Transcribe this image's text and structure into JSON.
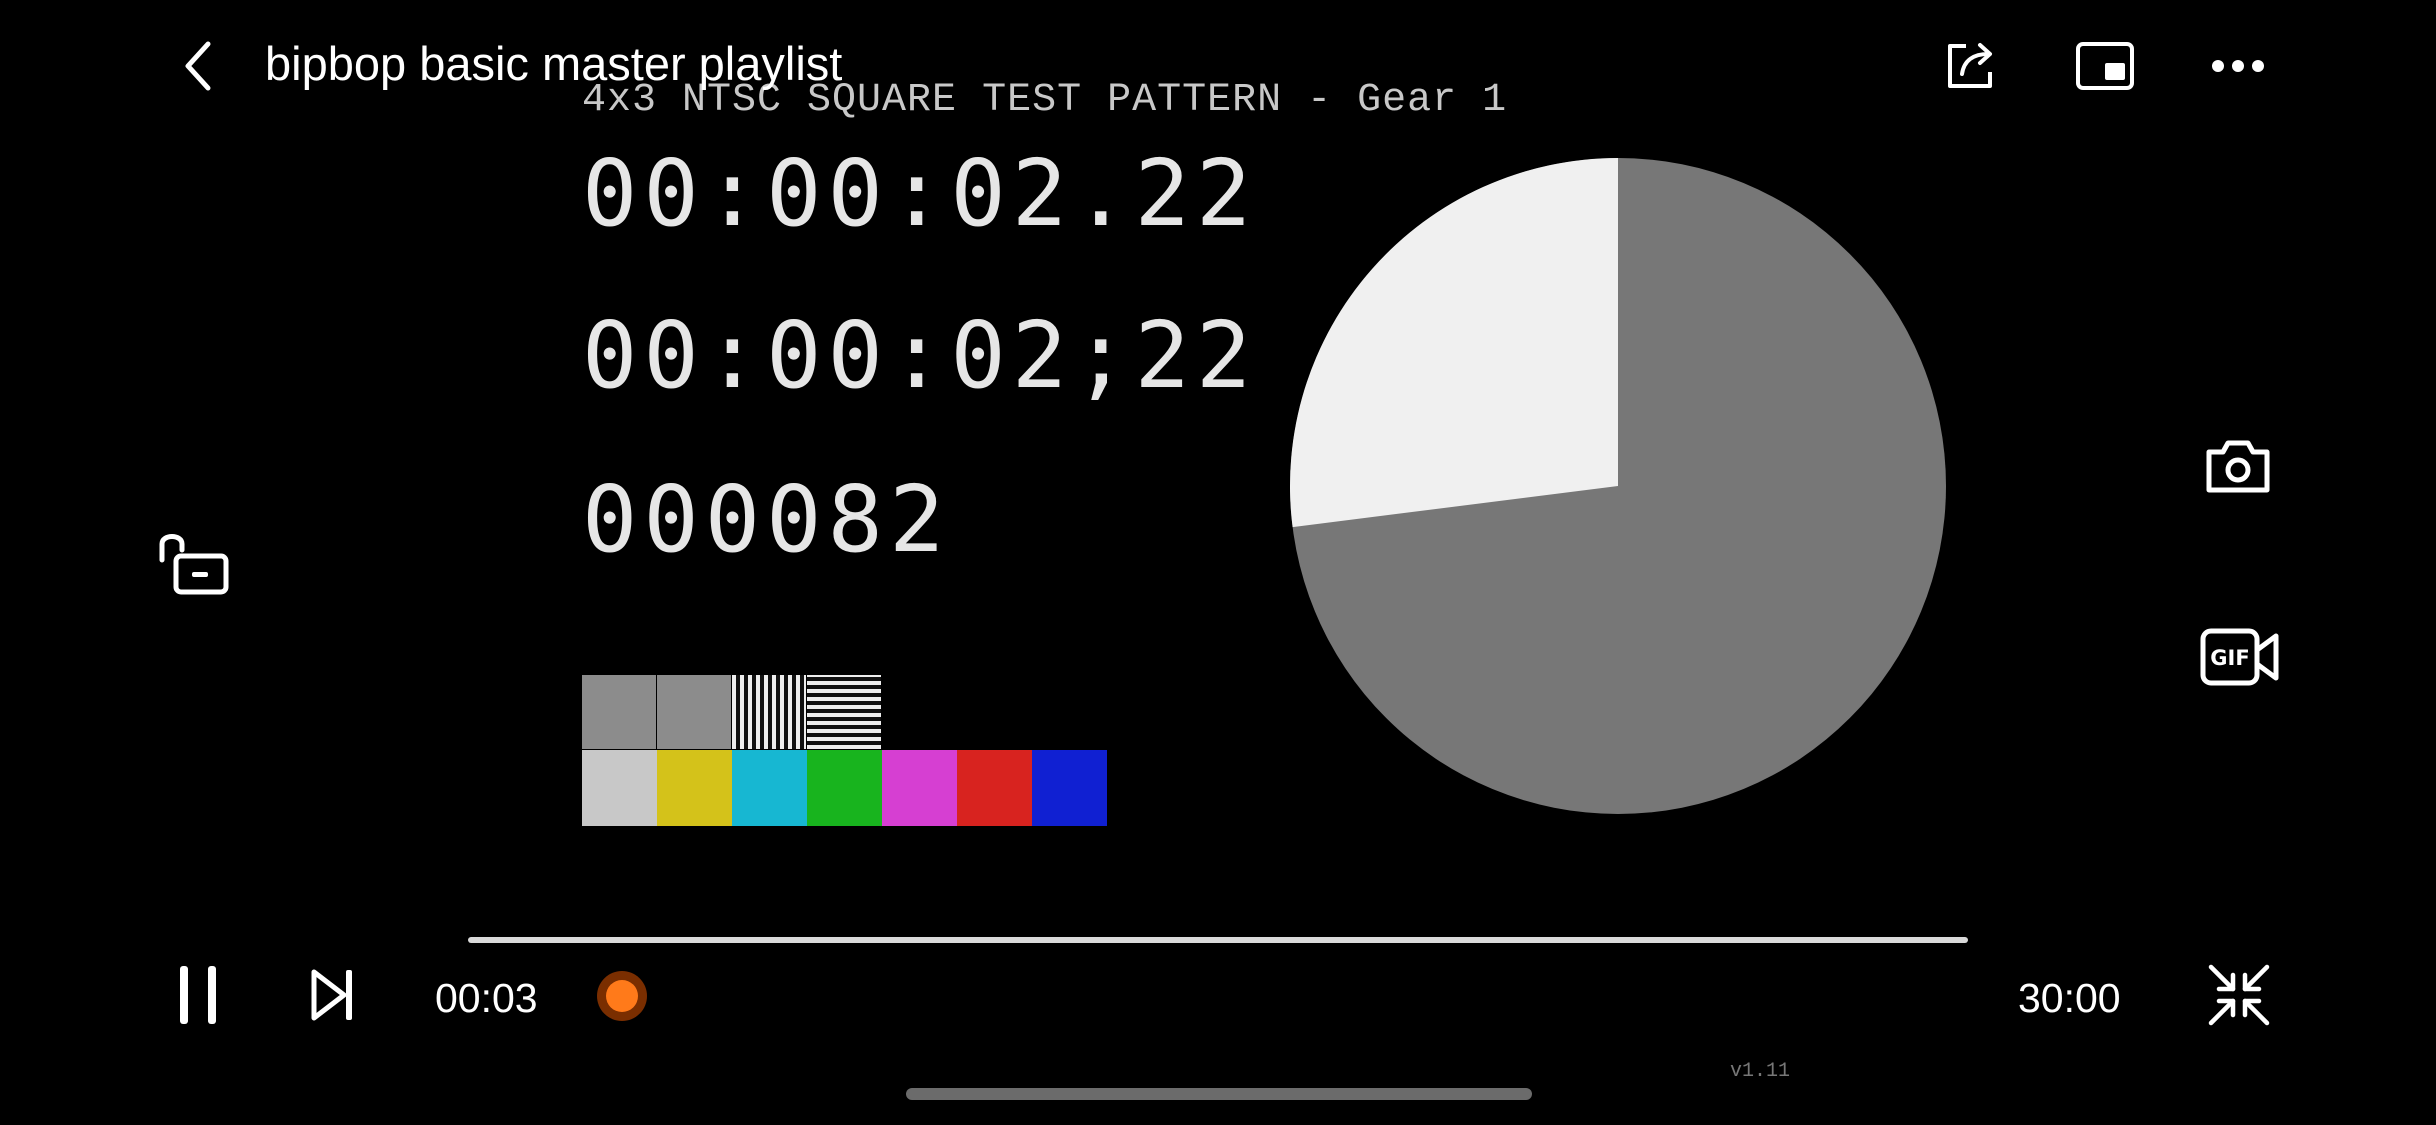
{
  "header": {
    "title": "bipbop basic master playlist",
    "back_icon": "chevron-left-icon",
    "share_icon": "share-icon",
    "pip_icon": "picture-in-picture-icon",
    "more_icon": "more-horizontal-icon"
  },
  "video_frame": {
    "pattern_title": "4x3 NTSC SQUARE TEST PATTERN - Gear 1",
    "timecode_decimal": "00:00:02.22",
    "timecode_dropframe": "00:00:02;22",
    "frame_counter": "000082",
    "version": "v1.11",
    "pie_fill_fraction": 0.27,
    "color_bars": [
      "#c8c8c8",
      "#d4c21a",
      "#17b7d2",
      "#18b41e",
      "#d63fd2",
      "#d8231f",
      "#1020d2"
    ],
    "gray_tiles": [
      "#8c8c8c",
      "#8c8c8c"
    ]
  },
  "side_controls": {
    "lock_icon": "unlock-icon",
    "screenshot_icon": "camera-icon",
    "gif_icon": "gif-record-icon"
  },
  "playback": {
    "current_time": "00:03",
    "total_time": "30:00",
    "progress_fraction": 0.0017,
    "pause_icon": "pause-icon",
    "next_icon": "skip-next-icon",
    "exit_fullscreen_icon": "exit-fullscreen-icon",
    "accent_color": "#ff7a1a"
  }
}
